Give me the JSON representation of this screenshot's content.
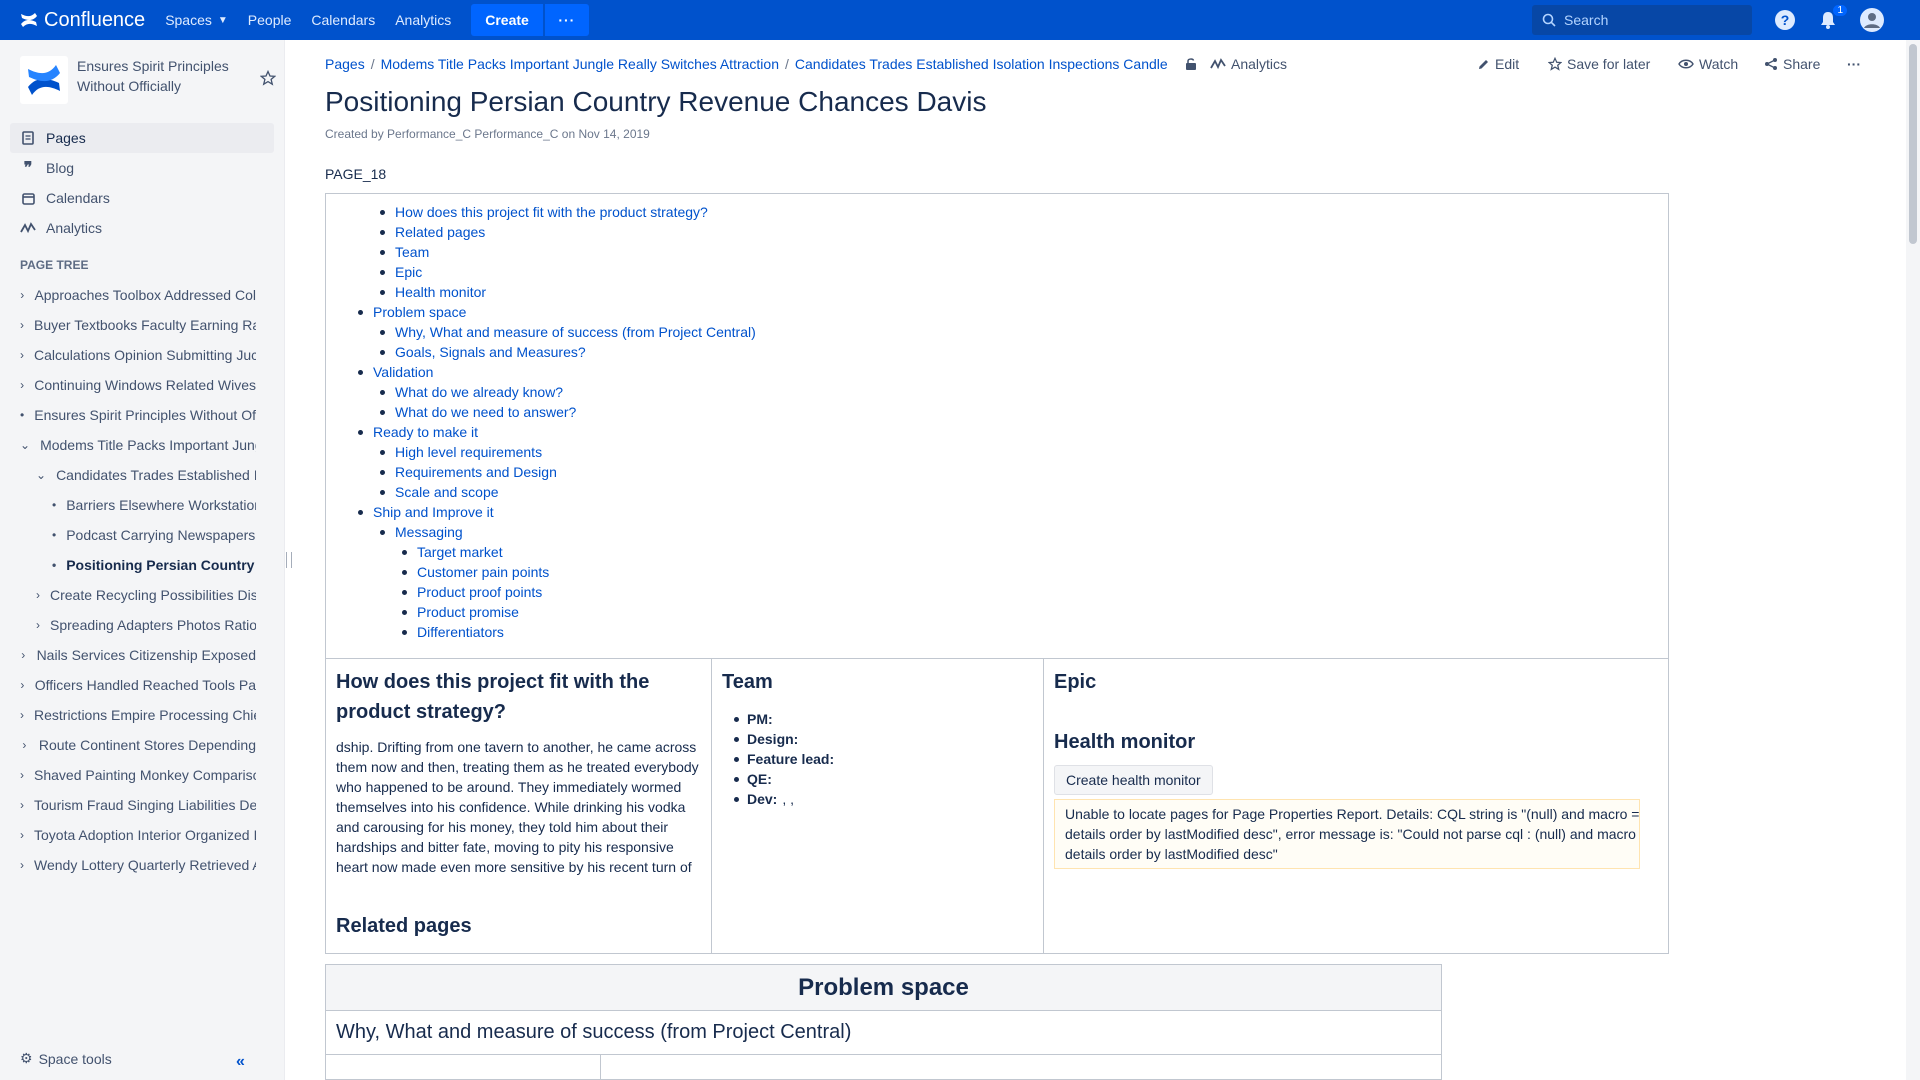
{
  "topnav": {
    "brand": "Confluence",
    "spaces": "Spaces",
    "people": "People",
    "calendars": "Calendars",
    "analytics": "Analytics",
    "create": "Create",
    "more": "···",
    "search_placeholder": "Search",
    "notifications_count": "1"
  },
  "sidebar": {
    "space_name": "Ensures Spirit Principles Without Officially",
    "links": [
      {
        "label": "Pages",
        "icon": "pages-icon"
      },
      {
        "label": "Blog",
        "icon": "blog-icon"
      },
      {
        "label": "Calendars",
        "icon": "calendar-icon"
      },
      {
        "label": "Analytics",
        "icon": "analytics-icon"
      }
    ],
    "tree_title": "PAGE TREE",
    "tree": [
      {
        "label": "Approaches Toolbox Addressed Col",
        "depth": 0,
        "toggle": "›"
      },
      {
        "label": "Buyer Textbooks Faculty Earning Ra",
        "depth": 0,
        "toggle": "›"
      },
      {
        "label": "Calculations Opinion Submitting Juc",
        "depth": 0,
        "toggle": "›"
      },
      {
        "label": "Continuing Windows Related Wives",
        "depth": 0,
        "toggle": "›"
      },
      {
        "label": "Ensures Spirit Principles Without Of",
        "depth": 0,
        "toggle": "•"
      },
      {
        "label": "Modems Title Packs Important Jung",
        "depth": 0,
        "toggle": "⌄"
      },
      {
        "label": "Candidates Trades Established Is",
        "depth": 1,
        "toggle": "⌄"
      },
      {
        "label": "Barriers Elsewhere Workstation",
        "depth": 2,
        "toggle": "•"
      },
      {
        "label": "Podcast Carrying Newspapers A",
        "depth": 2,
        "toggle": "•"
      },
      {
        "label": "Positioning Persian Country I",
        "depth": 2,
        "toggle": "•",
        "current": true
      },
      {
        "label": "Create Recycling Possibilities Dis",
        "depth": 1,
        "toggle": "›"
      },
      {
        "label": "Spreading Adapters Photos Ratio",
        "depth": 1,
        "toggle": "›"
      },
      {
        "label": "Nails Services Citizenship Exposed",
        "depth": 0,
        "toggle": "›"
      },
      {
        "label": "Officers Handled Reached Tools Pa",
        "depth": 0,
        "toggle": "›"
      },
      {
        "label": "Restrictions Empire Processing Chie",
        "depth": 0,
        "toggle": "›"
      },
      {
        "label": "Route Continent Stores Depending",
        "depth": 0,
        "toggle": "›"
      },
      {
        "label": "Shaved Painting Monkey Comparisc",
        "depth": 0,
        "toggle": "›"
      },
      {
        "label": "Tourism Fraud Singing Liabilities De",
        "depth": 0,
        "toggle": "›"
      },
      {
        "label": "Toyota Adoption Interior Organized I",
        "depth": 0,
        "toggle": "›"
      },
      {
        "label": "Wendy Lottery Quarterly Retrieved A",
        "depth": 0,
        "toggle": "›"
      }
    ],
    "space_tools": "Space tools",
    "collapse": "«"
  },
  "breadcrumbs": [
    "Pages",
    "Modems Title Packs Important Jungle Really Switches Attraction",
    "Candidates Trades Established Isolation Inspections Candle"
  ],
  "page_analytics": "Analytics",
  "actions": {
    "edit": "Edit",
    "save": "Save for later",
    "watch": "Watch",
    "share": "Share",
    "more": "···"
  },
  "page": {
    "title": "Positioning Persian Country Revenue Chances Davis",
    "byline": "Created by Performance_C Performance_C on Nov 14, 2019",
    "code": "PAGE_18"
  },
  "toc": [
    {
      "label": "How does this project fit with the product strategy?",
      "level": 1
    },
    {
      "label": "Related pages",
      "level": 1
    },
    {
      "label": "Team",
      "level": 1
    },
    {
      "label": "Epic",
      "level": 1
    },
    {
      "label": "Health monitor",
      "level": 1
    },
    {
      "label": "Problem space",
      "level": 0
    },
    {
      "label": "Why, What and measure of success (from Project Central)",
      "level": 1
    },
    {
      "label": "Goals, Signals and Measures?",
      "level": 1
    },
    {
      "label": "Validation",
      "level": 0
    },
    {
      "label": "What do we already know?",
      "level": 1
    },
    {
      "label": "What do we need to answer?",
      "level": 1
    },
    {
      "label": "Ready to make it",
      "level": 0
    },
    {
      "label": "High level requirements",
      "level": 1
    },
    {
      "label": "Requirements and Design",
      "level": 1
    },
    {
      "label": "Scale and scope",
      "level": 1
    },
    {
      "label": "Ship and Improve it",
      "level": 0
    },
    {
      "label": "Messaging",
      "level": 1
    },
    {
      "label": "Target market",
      "level": 2
    },
    {
      "label": "Customer pain points",
      "level": 2
    },
    {
      "label": "Product proof points",
      "level": 2
    },
    {
      "label": "Product promise",
      "level": 2
    },
    {
      "label": "Differentiators",
      "level": 2
    }
  ],
  "strategy": {
    "heading": "How does this project fit with the product strategy?",
    "body": "dship. Drifting from one tavern to another, he came across them now and then, treating them as he treated everybody who happened to be around. They immediately wormed themselves into his confidence. While drinking his vodka and carousing for his money, they told him about their hardships and bitter fate, moving to pity his responsive heart now made even more sensitive by his recent turn of",
    "related": "Related pages"
  },
  "team": {
    "heading": "Team",
    "members": [
      "PM:",
      "Design:",
      "Feature lead:",
      "QE:",
      "Dev:"
    ],
    "dev_suffix": ", ,"
  },
  "epic": {
    "heading": "Epic",
    "health_heading": "Health monitor",
    "create_button": "Create health monitor",
    "error_lines": [
      "Unable to locate pages for Page Properties Report. Details: CQL string is \"(null) and macro =",
      "details order by lastModified desc\", error message is: \"Could not parse cql : (null) and macro =",
      "details order by lastModified desc\""
    ]
  },
  "problem": {
    "heading": "Problem space",
    "sub": "Why, What and measure of success (from Project Central)"
  }
}
